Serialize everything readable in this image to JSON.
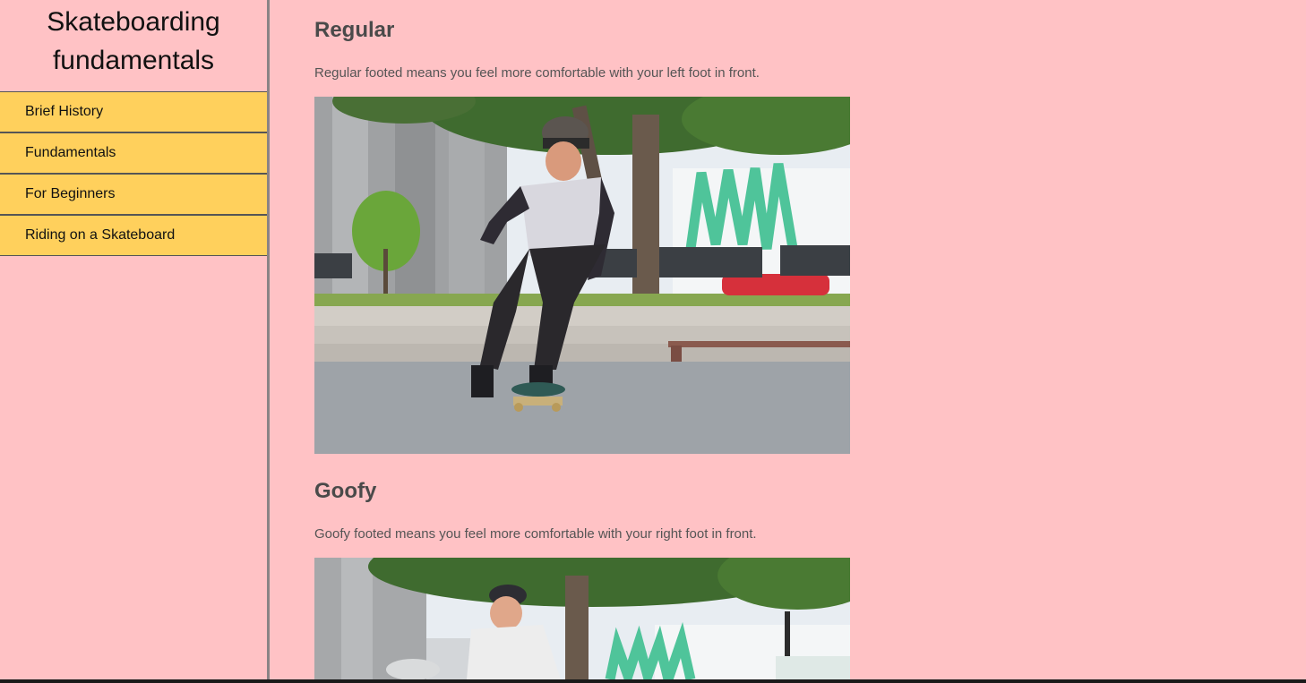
{
  "sidebar": {
    "title": "Skateboarding fundamentals",
    "items": [
      {
        "label": "Brief History"
      },
      {
        "label": "Fundamentals"
      },
      {
        "label": "For Beginners"
      },
      {
        "label": "Riding on a Skateboard"
      }
    ]
  },
  "sections": [
    {
      "heading": "Regular",
      "text": "Regular footed means you feel more comfortable with your left foot in front.",
      "image": "photo of a skateboarder in a beanie pushing off with the left foot forward in a skate plaza"
    },
    {
      "heading": "Goofy",
      "text": "Goofy footed means you feel more comfortable with your right foot in front.",
      "image": "photo of a skateboarder in a cap crouching in a skate plaza"
    }
  ],
  "colors": {
    "background": "#ffc2c5",
    "nav_background": "#ffd05c",
    "sidebar_border": "#8a8385",
    "heading": "#4a4a4a"
  }
}
